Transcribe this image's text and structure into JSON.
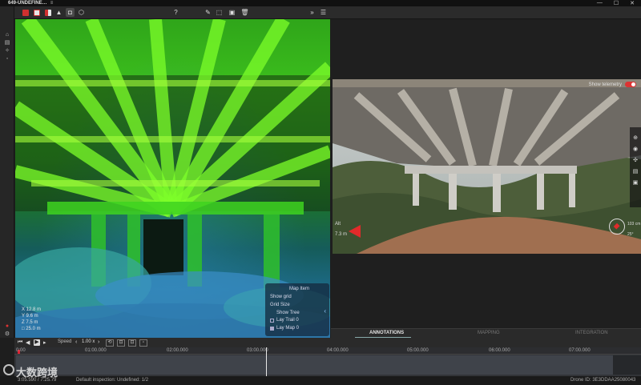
{
  "window": {
    "title": "649-UNDEFINE…",
    "menu_glyph": "≡",
    "min": "—",
    "max": "☐",
    "close": "✕"
  },
  "toolbar": {
    "help": "?",
    "icons": [
      "red-cube-icon",
      "white-cube-icon",
      "split-cube-icon",
      "measure-icon",
      "camera-icon",
      "wire-cube-icon",
      "help-icon",
      "pen-icon",
      "select-icon",
      "save-icon",
      "trash-icon",
      "expand-icon",
      "sliders-icon"
    ]
  },
  "cloud": {
    "coords": [
      "X  12.8 m",
      "Y  9.6 m",
      "Z  7.5 m",
      "□  25.0 m"
    ],
    "map_items": {
      "title": "Map Item",
      "items": [
        "Show grid",
        "Grid Size",
        "Show Tree",
        "Lay Trail 0",
        "Lay Map 0"
      ]
    }
  },
  "camera": {
    "telemetry_label": "Show telemetry",
    "alt_label": "Alt",
    "alt_value": "7.3 m",
    "heading_value": "103 cm",
    "heading_value2": "25°"
  },
  "tabs": [
    {
      "label": "ANNOTATIONS",
      "active": true
    },
    {
      "label": "MAPPING",
      "active": false
    },
    {
      "label": "INTEGRATION",
      "active": false
    }
  ],
  "playback": {
    "speed_label": "Speed",
    "speed_value": "1.00 x"
  },
  "timeline": {
    "ticks": [
      "0:00",
      "01:00.000",
      "02:00.000",
      "03:00.000",
      "04:00.000",
      "05:00.000",
      "06:00.000",
      "07:00.000"
    ]
  },
  "status": {
    "time": "3:05.590 / 7:25.79",
    "inspection": "Default inspection: Undefined: 1/2",
    "drone": "Drone ID:   3E3DDAA25080043"
  },
  "watermark": "大数跨境",
  "colors": {
    "accent_red": "#d33333",
    "cloud_green": "#3bbd1c",
    "cloud_blue": "#1d6a88",
    "panel_dark": "#1e1e1e"
  }
}
